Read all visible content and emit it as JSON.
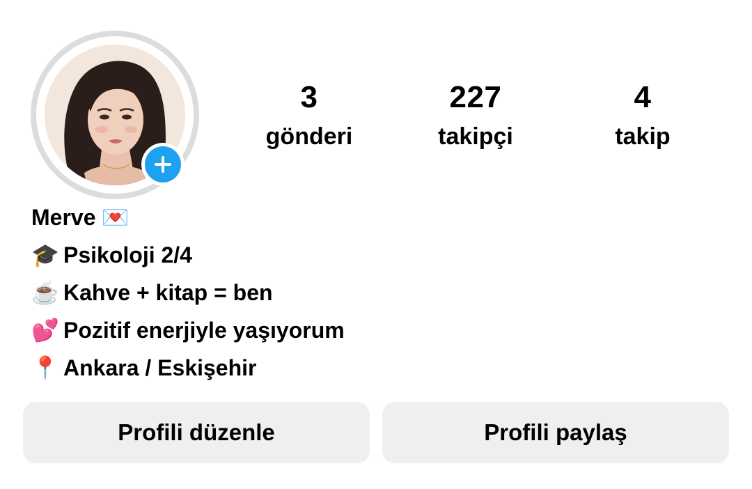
{
  "profile": {
    "stats": {
      "posts": {
        "count": "3",
        "label": "gönderi"
      },
      "followers": {
        "count": "227",
        "label": "takipçi"
      },
      "following": {
        "count": "4",
        "label": "takip"
      }
    },
    "bio": {
      "name": "Merve",
      "name_emoji": "💌",
      "lines": [
        {
          "emoji": "🎓",
          "text": "Psikoloji 2/4"
        },
        {
          "emoji": "☕",
          "text": "Kahve + kitap = ben"
        },
        {
          "emoji": "💕",
          "text": "Pozitif enerjiyle yaşıyorum"
        },
        {
          "emoji": "📍",
          "text": "Ankara / Eskişehir"
        }
      ]
    },
    "buttons": {
      "edit_label": "Profili düzenle",
      "share_label": "Profili paylaş"
    },
    "icons": {
      "add_story": "plus-icon",
      "avatar": "profile-photo"
    },
    "colors": {
      "accent_blue": "#1fa1f1",
      "button_bg": "#efefef",
      "ring": "#dcdcdc"
    }
  }
}
